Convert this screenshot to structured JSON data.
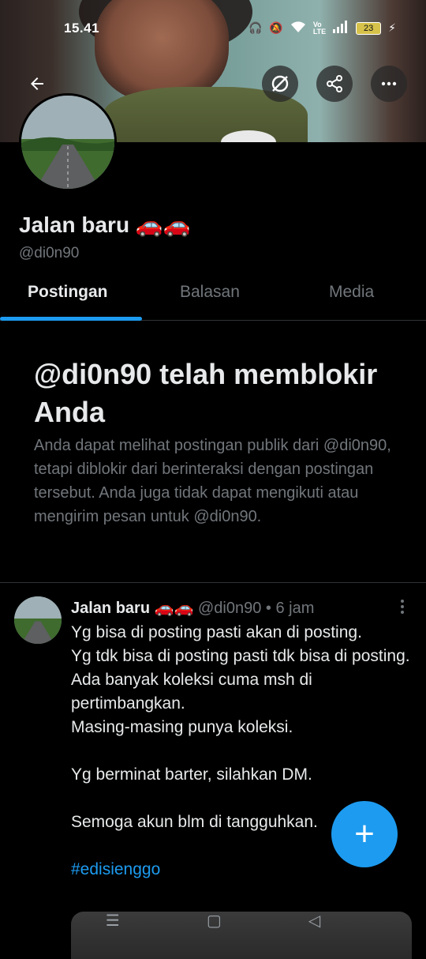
{
  "status_bar": {
    "time": "15.41",
    "battery": "23"
  },
  "profile": {
    "name": "Jalan baru 🚗🚗",
    "handle": "@di0n90"
  },
  "tabs": [
    {
      "label": "Postingan",
      "active": true
    },
    {
      "label": "Balasan",
      "active": false
    },
    {
      "label": "Media",
      "active": false
    }
  ],
  "block_notice": {
    "title": "@di0n90 telah memblokir Anda",
    "text": "Anda dapat melihat postingan publik dari @di0n90, tetapi diblokir dari berinteraksi dengan postingan tersebut. Anda juga tidak dapat mengikuti atau mengirim pesan untuk @di0n90."
  },
  "post": {
    "author_name": "Jalan baru 🚗🚗",
    "author_handle": "@di0n90",
    "time": "• 6 jam",
    "lines": [
      "Yg bisa di posting pasti akan di posting.",
      "Yg tdk bisa di posting pasti tdk bisa di posting.",
      "Ada banyak koleksi cuma msh di pertimbangkan.",
      "Masing-masing punya koleksi.",
      "",
      "Yg berminat barter, silahkan DM.",
      "",
      "Semoga akun blm di tangguhkan."
    ],
    "hashtag": "#edisienggo"
  },
  "fab": {
    "label": "+"
  },
  "colors": {
    "accent": "#1d9bf0",
    "secondary_text": "#71767b",
    "background": "#000000"
  }
}
